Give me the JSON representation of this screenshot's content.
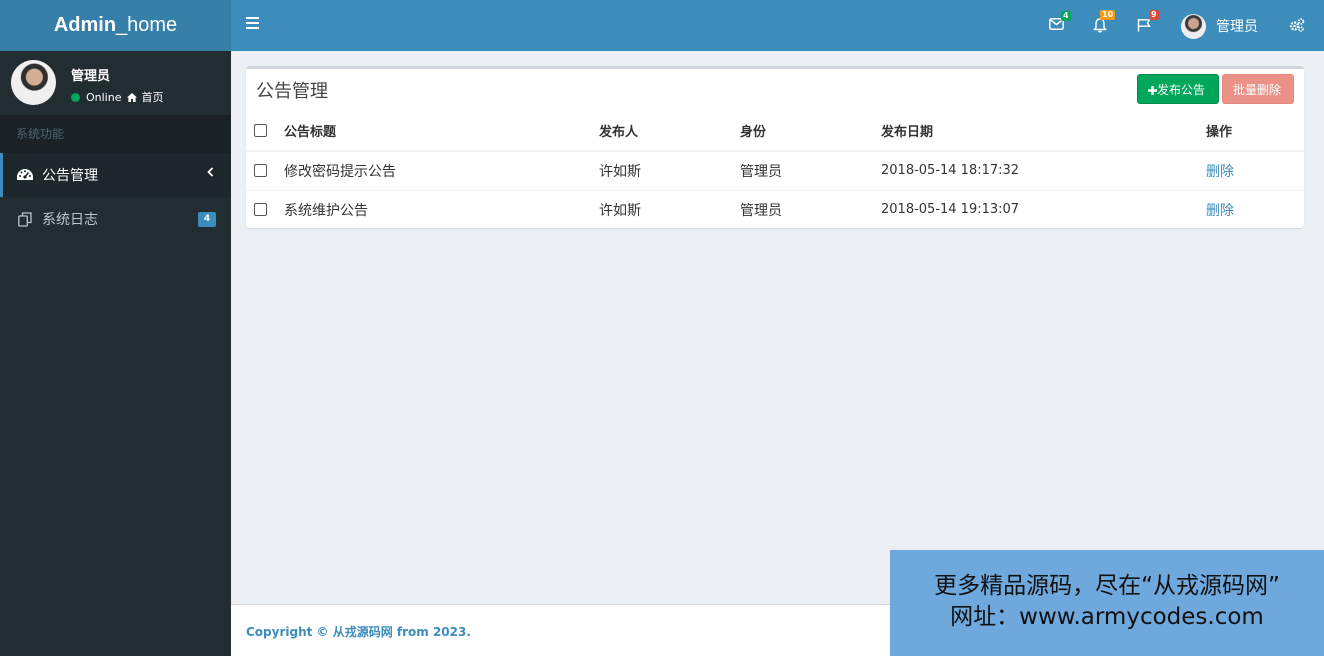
{
  "header": {
    "logo_bold": "Admin",
    "logo_rest": "_home",
    "mail_count": "4",
    "notif_count": "10",
    "flag_count": "9",
    "user_name": "管理员",
    "colors": {
      "header": "#3c8dbc",
      "logo_bg": "#367fa9",
      "mail_badge": "#00a65a",
      "notif_badge": "#f39c12",
      "flag_badge": "#dd4b39"
    }
  },
  "sidebar": {
    "user_name": "管理员",
    "status": "Online",
    "home_link": "首页",
    "section_header": "系统功能",
    "items": [
      {
        "label": "公告管理",
        "icon": "dashboard-icon",
        "active": true
      },
      {
        "label": "系统日志",
        "icon": "copy-icon",
        "badge": "4"
      }
    ]
  },
  "main": {
    "title": "公告管理",
    "publish_button": "发布公告",
    "batch_delete_button": "批量删除",
    "columns": [
      "公告标题",
      "发布人",
      "身份",
      "发布日期",
      "操作"
    ],
    "rows": [
      {
        "title": "修改密码提示公告",
        "publisher": "许如斯",
        "role": "管理员",
        "date": "2018-05-14 18:17:32",
        "action": "删除"
      },
      {
        "title": "系统维护公告",
        "publisher": "许如斯",
        "role": "管理员",
        "date": "2018-05-14 19:13:07",
        "action": "删除"
      }
    ]
  },
  "footer": {
    "copyright": "Copyright © 从戎源码网 from 2023."
  },
  "watermark": {
    "line1": "更多精品源码，尽在“从戎源码网”",
    "line2": "网址：www.armycodes.com"
  }
}
